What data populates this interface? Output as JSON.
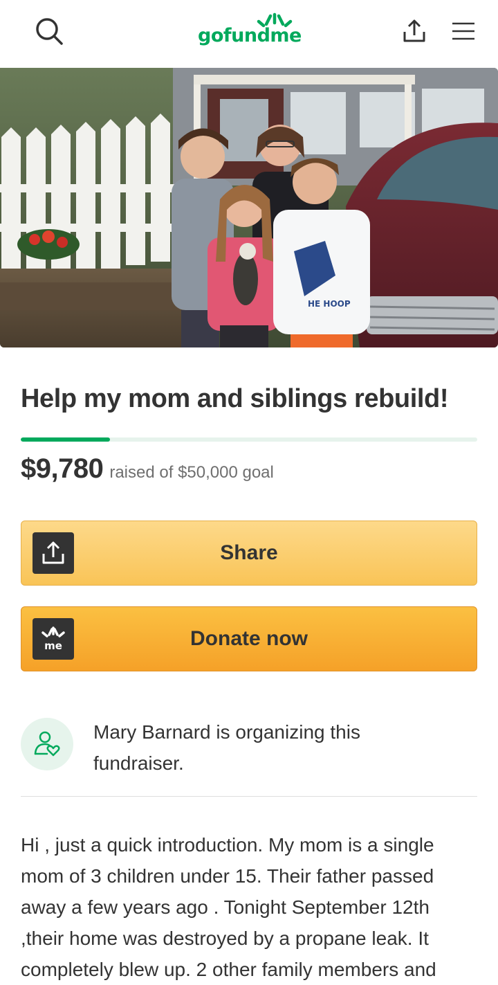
{
  "header": {
    "logo_text": "gofundme",
    "search_icon": "search-icon",
    "share_icon": "share-upload-icon",
    "menu_icon": "hamburger-menu-icon"
  },
  "hero": {
    "image": "family-photo"
  },
  "campaign": {
    "title": "Help my mom and siblings rebuild!",
    "raised_amount": "$9,780",
    "raised_label": "raised of $50,000 goal",
    "progress_fraction": 0.1956
  },
  "actions": {
    "share_label": "Share",
    "donate_label": "Donate now",
    "share_icon": "share-upload-icon",
    "donate_icon": "gofundme-me-icon"
  },
  "organizer": {
    "text": "Mary Barnard is organizing this fundraiser.",
    "icon": "person-heart-icon"
  },
  "story": {
    "text": "Hi , just a quick introduction. My mom is a single mom of 3 children under 15. Their father passed away a few years ago . Tonight September 12th ,their home was destroyed by a propane leak. It completely blew up. 2 other family members and"
  },
  "colors": {
    "brand_green": "#02a95c",
    "share_yellow": "#f9c457",
    "donate_orange": "#f5a128",
    "text_dark": "#333333"
  }
}
